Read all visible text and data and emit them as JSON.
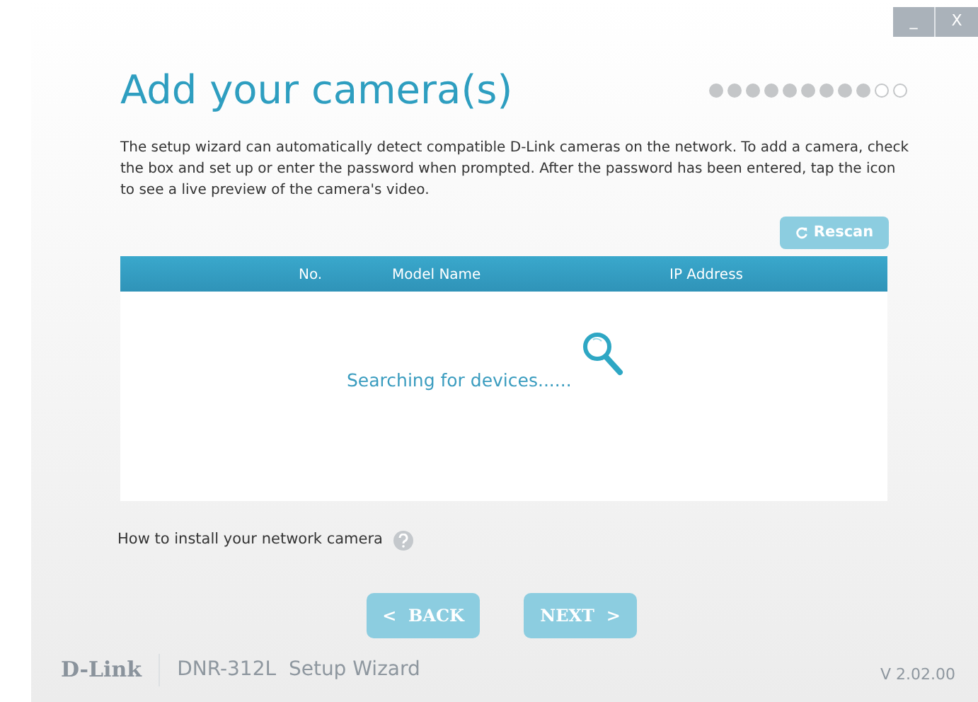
{
  "window_controls": [
    "_",
    "X"
  ],
  "title": "Add your camera(s)",
  "progress_steps": [
    {
      "completed": true
    },
    {
      "completed": true
    },
    {
      "completed": true
    },
    {
      "completed": true
    },
    {
      "completed": true
    },
    {
      "completed": true
    },
    {
      "completed": true
    },
    {
      "completed": true
    },
    {
      "completed": true
    },
    {
      "completed": false
    },
    {
      "completed": false
    }
  ],
  "description": "The setup wizard can automatically detect compatible D-Link cameras on the network. To add a camera, check the box and set up or enter the password when prompted. After the password has been entered, tap the icon to see a live preview of the camera's video.",
  "rescan_button": "Rescan",
  "table": {
    "columns": [
      "No.",
      "Model Name",
      "IP Address"
    ],
    "status": "Searching for devices......"
  },
  "help_link": "How to install your network camera",
  "buttons": [
    "<  BACK",
    "NEXT  >"
  ],
  "footer": {
    "logo": "D-Link",
    "product": "DNR-312L  Setup Wizard",
    "version": "V 2.02.00"
  }
}
